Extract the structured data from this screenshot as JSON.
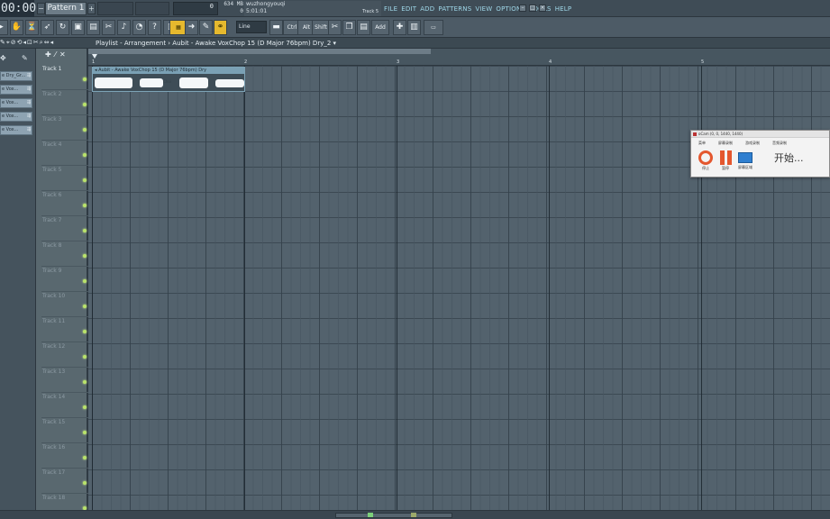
{
  "topbar": {
    "time": "00:00",
    "pattern_label": "Pattern 1",
    "tempo_value": "0",
    "memory": "634 MB",
    "cpu_line": "0",
    "hint_user": "wuzhongyouqi",
    "hint_time": "5:01:01",
    "hint_track": "Track 5",
    "menu": [
      "FILE",
      "EDIT",
      "ADD",
      "PATTERNS",
      "VIEW",
      "OPTIONS",
      "TOOLS",
      "HELP"
    ]
  },
  "toolbar": {
    "snap_value": "Line",
    "ctrl_label": "Ctrl",
    "alt_label": "Alt",
    "shift_label": "Shift",
    "add_label": "Add"
  },
  "playlist": {
    "title": "Playlist - Arrangement › Aubit - Awake VoxChop 15 (D Major 76bpm) Dry_2 ▾",
    "ruler": [
      "1",
      "2",
      "3",
      "4",
      "5"
    ],
    "tracks": [
      "Track 1",
      "Track 2",
      "Track 3",
      "Track 4",
      "Track 5",
      "Track 6",
      "Track 7",
      "Track 8",
      "Track 9",
      "Track 10",
      "Track 11",
      "Track 12",
      "Track 13",
      "Track 14",
      "Track 15",
      "Track 16",
      "Track 17",
      "Track 18"
    ],
    "clip_name": "◂ Aubit - Awake VoxChop 15 (D Major 76bpm) Dry",
    "clip_mid": "Choi"
  },
  "browser": {
    "items": [
      "e Dry_Gr...",
      "e Vox...",
      "e Vox...",
      "e Vox...",
      "e Vox..."
    ]
  },
  "record_window": {
    "title": "oCam (0, 0, 1440, 1440)",
    "menu": [
      "菜单",
      "屏幕录制",
      "游戏录制",
      "音频录制"
    ],
    "buttons": [
      "停止",
      "暂停",
      "屏幕区域"
    ],
    "status": "开始..."
  }
}
